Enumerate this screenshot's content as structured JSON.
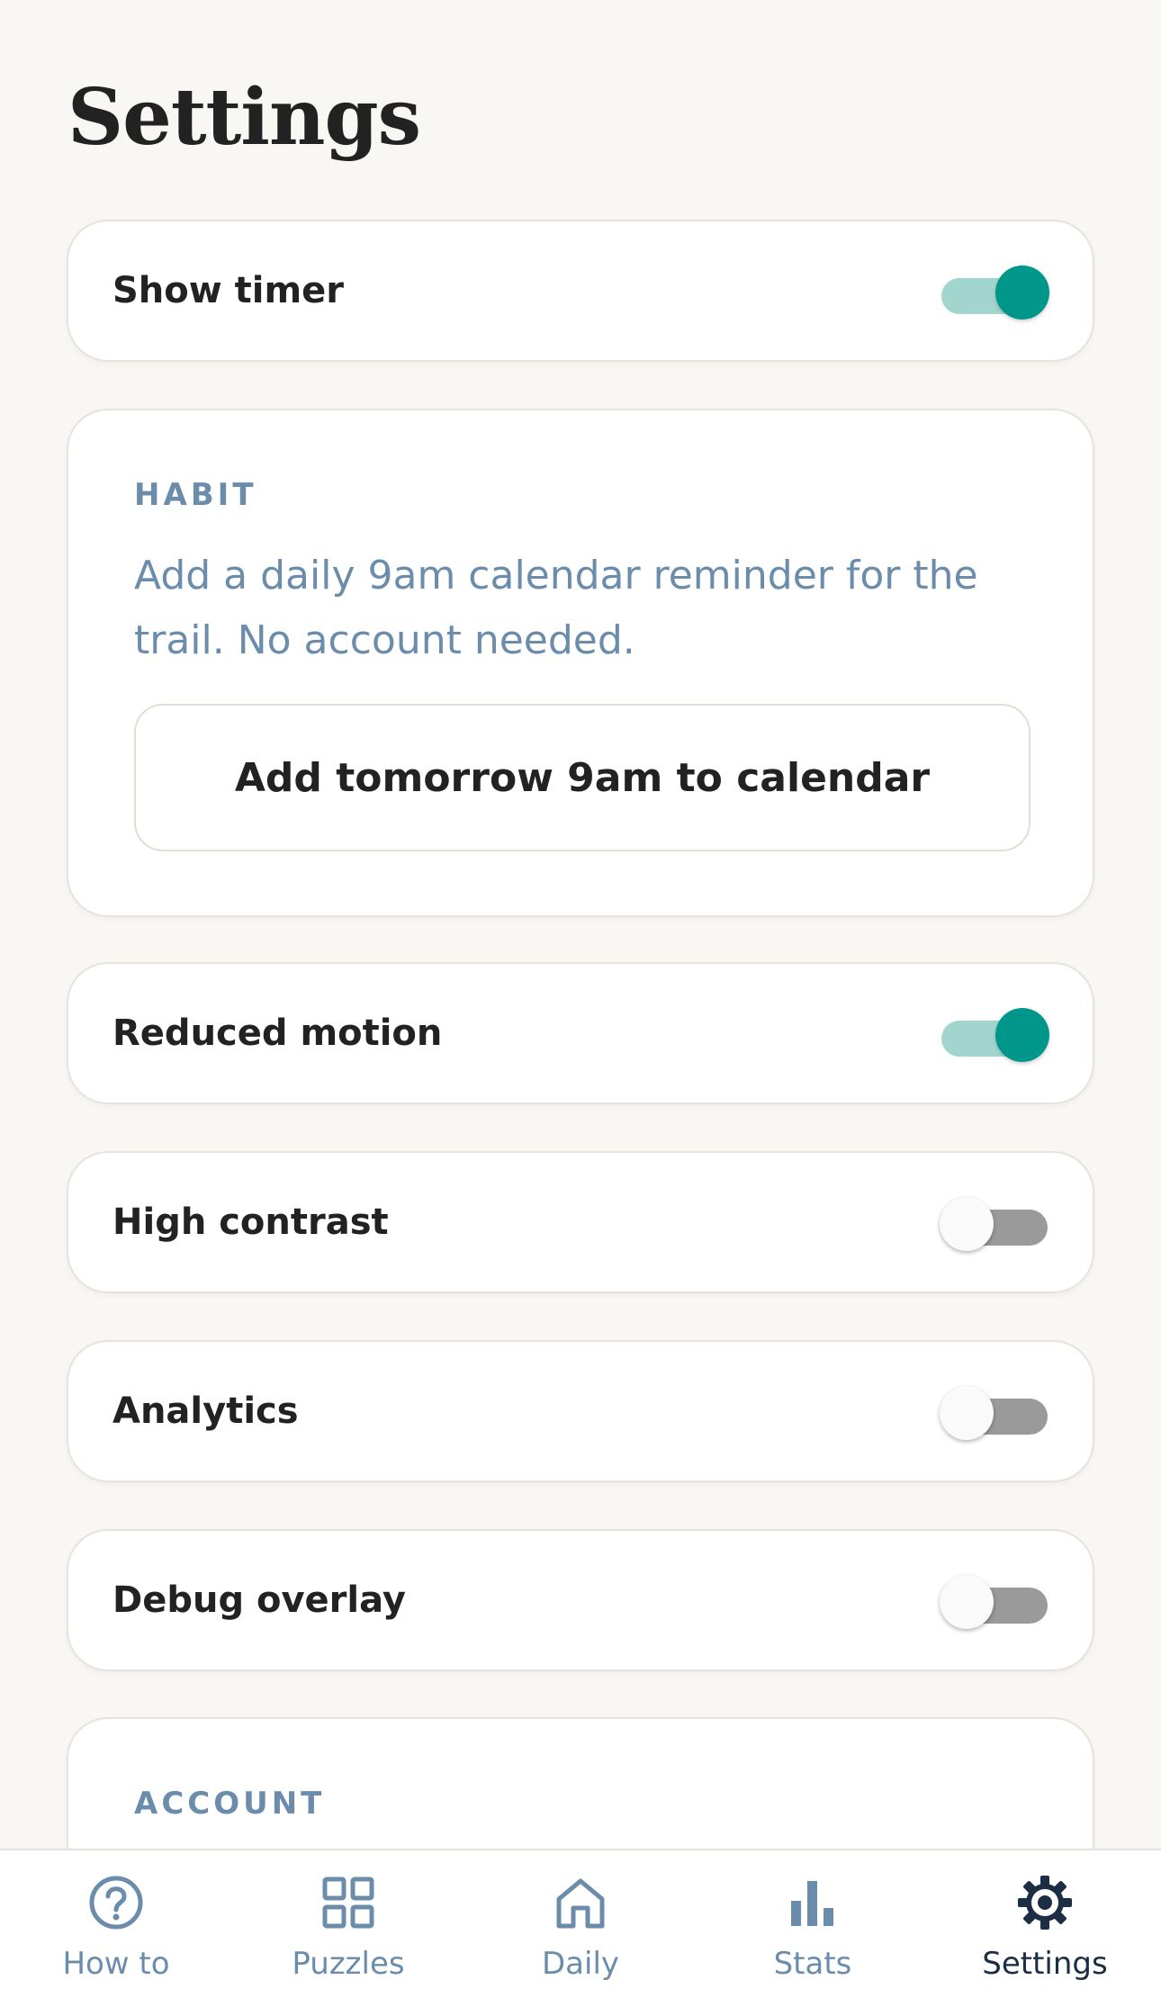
{
  "page_title": "Settings",
  "settings": {
    "show_timer": {
      "label": "Show timer",
      "enabled": true
    },
    "reduced_motion": {
      "label": "Reduced motion",
      "enabled": true
    },
    "high_contrast": {
      "label": "High contrast",
      "enabled": false
    },
    "analytics": {
      "label": "Analytics",
      "enabled": false
    },
    "debug_overlay": {
      "label": "Debug overlay",
      "enabled": false
    }
  },
  "habit": {
    "heading": "HABIT",
    "description": "Add a daily 9am calendar reminder for the trail. No account needed.",
    "button_label": "Add tomorrow 9am to calendar"
  },
  "account": {
    "heading": "ACCOUNT"
  },
  "tabbar": {
    "tabs": [
      {
        "label": "How to",
        "icon": "help-circle-icon",
        "active": false
      },
      {
        "label": "Puzzles",
        "icon": "grid-icon",
        "active": false
      },
      {
        "label": "Daily",
        "icon": "home-icon",
        "active": false
      },
      {
        "label": "Stats",
        "icon": "bar-chart-icon",
        "active": false
      },
      {
        "label": "Settings",
        "icon": "gear-icon",
        "active": true
      }
    ]
  },
  "colors": {
    "accent": "#00978a",
    "accent_track": "#a3d5cf",
    "muted_blue": "#6b8cab",
    "active_tab": "#1c2e44",
    "background": "#f8f7f4"
  }
}
